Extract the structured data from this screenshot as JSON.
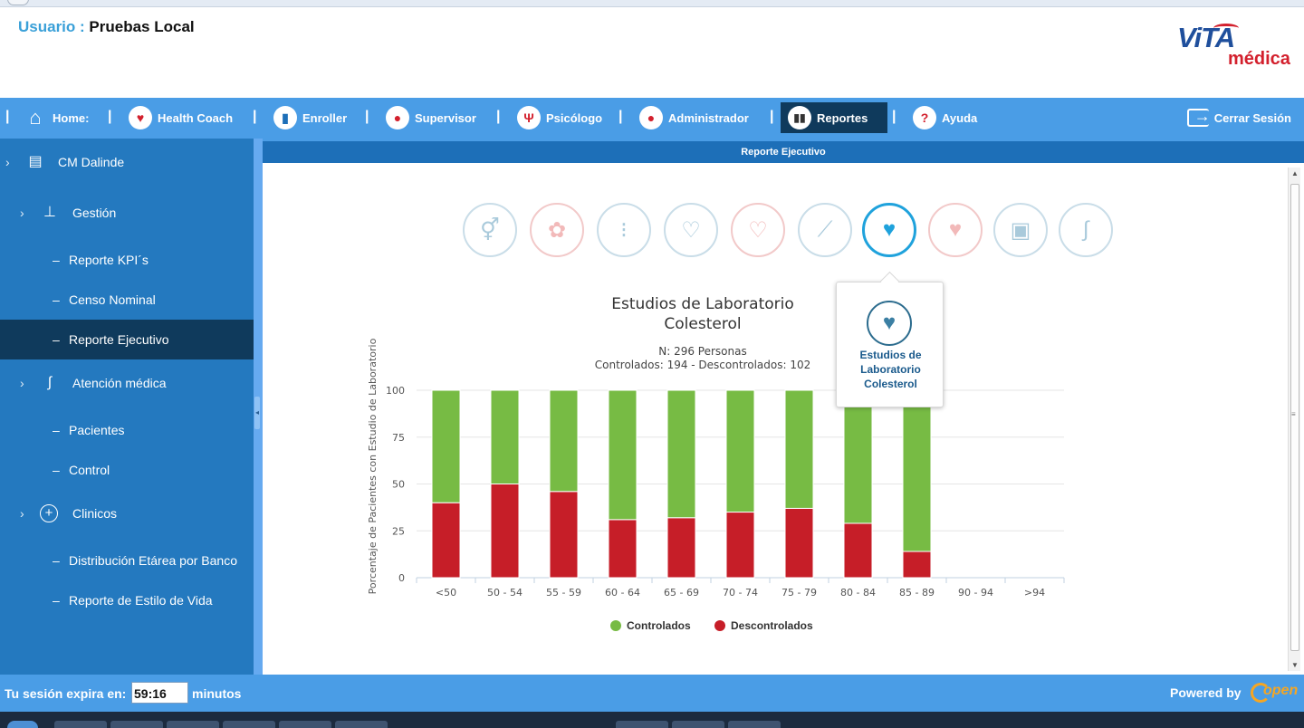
{
  "header": {
    "user_label": "Usuario :",
    "user_name": "Pruebas Local",
    "logo_main": "ViTA",
    "logo_sub": "médica"
  },
  "nav": {
    "items": [
      {
        "label": "Home:",
        "icon": "home-icon"
      },
      {
        "label": "Health Coach",
        "icon": "heart-pulse-icon"
      },
      {
        "label": "Enroller",
        "icon": "book-icon"
      },
      {
        "label": "Supervisor",
        "icon": "person-icon"
      },
      {
        "label": "Psicólogo",
        "icon": "psi-icon"
      },
      {
        "label": "Administrador",
        "icon": "person-icon"
      },
      {
        "label": "Reportes",
        "icon": "bar-chart-icon"
      },
      {
        "label": "Ayuda",
        "icon": "help-icon"
      }
    ],
    "active": "Reportes",
    "logout": "Cerrar Sesión"
  },
  "sidebar": {
    "items": [
      {
        "label": "CM Dalinde",
        "level": 0,
        "icon": "clipboard-icon"
      },
      {
        "label": "Gestión",
        "level": 1,
        "icon": "org-chart-icon"
      },
      {
        "label": "Reporte KPI´s",
        "level": 2
      },
      {
        "label": "Censo Nominal",
        "level": 2
      },
      {
        "label": "Reporte Ejecutivo",
        "level": 2,
        "active": true
      },
      {
        "label": "Atención médica",
        "level": 1,
        "icon": "stethoscope-icon"
      },
      {
        "label": "Pacientes",
        "level": 2
      },
      {
        "label": "Control",
        "level": 2
      },
      {
        "label": "Clinicos",
        "level": 1,
        "icon": "plus-circle-icon"
      },
      {
        "label": "Distribución Etárea por Banco",
        "level": 2
      },
      {
        "label": "Reporte de Estilo de Vida",
        "level": 2
      }
    ]
  },
  "content": {
    "title": "Reporte Ejecutivo",
    "report_icons": [
      {
        "name": "gender-icon",
        "tone": "blue"
      },
      {
        "name": "virus-icon",
        "tone": "red"
      },
      {
        "name": "traffic-light-icon",
        "tone": "blue"
      },
      {
        "name": "heart-ecg-icon",
        "tone": "blue"
      },
      {
        "name": "heart-drop-icon",
        "tone": "red"
      },
      {
        "name": "artery-icon",
        "tone": "blue"
      },
      {
        "name": "heart-icon",
        "tone": "active"
      },
      {
        "name": "heart-monitor-icon",
        "tone": "red"
      },
      {
        "name": "glucometer-icon",
        "tone": "blue"
      },
      {
        "name": "stethoscope-icon",
        "tone": "blue"
      }
    ],
    "tooltip": {
      "line1": "Estudios de",
      "line2": "Laboratorio",
      "line3": "Colesterol"
    }
  },
  "chart_data": {
    "type": "bar",
    "stacked": true,
    "title": "Estudios de Laboratorio",
    "title2": "Colesterol",
    "subtitle1": "N: 296 Personas",
    "subtitle2": "Controlados: 194 - Descontrolados: 102",
    "ylabel": "Porcentaje de Pacientes con Estudio de Laboratorio",
    "ylim": [
      0,
      100
    ],
    "yticks": [
      0,
      25,
      50,
      75,
      100
    ],
    "categories": [
      "<50",
      "50 - 54",
      "55 - 59",
      "60 - 64",
      "65 - 69",
      "70 - 74",
      "75 - 79",
      "80 - 84",
      "85 - 89",
      "90 - 94",
      ">94"
    ],
    "series": [
      {
        "name": "Controlados",
        "color": "#77bb44",
        "values": [
          60,
          50,
          54,
          69,
          68,
          65,
          63,
          71,
          86,
          0,
          0
        ]
      },
      {
        "name": "Descontrolados",
        "color": "#c61e28",
        "values": [
          40,
          50,
          46,
          31,
          32,
          35,
          37,
          29,
          14,
          0,
          0
        ]
      }
    ],
    "grid": true,
    "legend": "bottom-center"
  },
  "footer": {
    "expires_label": "Tu sesión expira en:",
    "timer": "59:16",
    "minutes_label": "minutos",
    "powered_by": "Powered by",
    "brand": "open"
  }
}
